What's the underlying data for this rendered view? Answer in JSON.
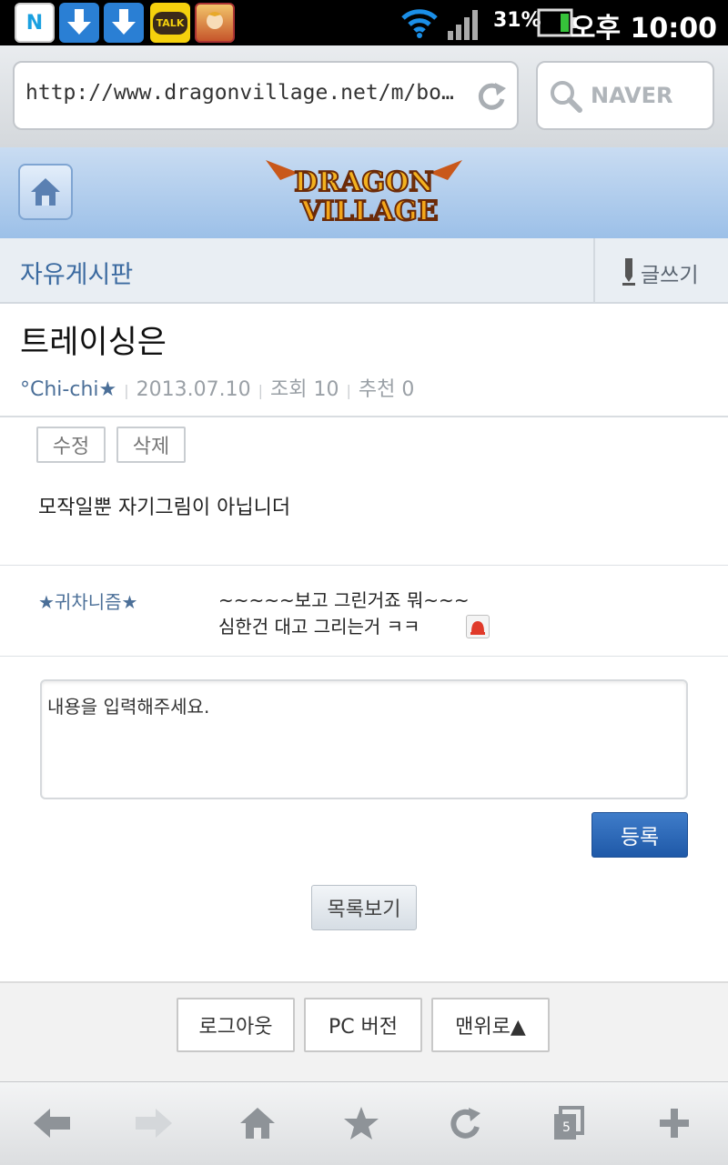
{
  "status_bar": {
    "notification_icons": [
      "naver-icon",
      "download-icon",
      "download-icon",
      "kakaotalk-icon",
      "game-app-icon"
    ],
    "kakao_label": "TALK",
    "naver_label": "N",
    "battery_percent": "31%",
    "time": "오후 10:00"
  },
  "browser": {
    "url": "http://www.dragonvillage.net/m/bo…",
    "search_placeholder": "NAVER"
  },
  "site": {
    "logo_text": "DRAGON VILLAGE",
    "board_name": "자유게시판",
    "write_label": "글쓰기"
  },
  "post": {
    "title": "트레이싱은",
    "author": "°Chi-chi★",
    "date": "2013.07.10",
    "views": "조회 10",
    "recommend": "추천 0",
    "edit_label": "수정",
    "delete_label": "삭제",
    "body": "모작일뿐 자기그림이 아닙니더"
  },
  "comments": [
    {
      "author": "★귀차니즘★",
      "lines": [
        "~~~~~보고 그린거죠 뭐~~~",
        "심한건 대고 그리는거 ㅋㅋ"
      ]
    }
  ],
  "reply": {
    "placeholder": "내용을 입력해주세요.",
    "submit_label": "등록",
    "list_label": "목록보기"
  },
  "footer": {
    "logout": "로그아웃",
    "pc_version": "PC 버전",
    "to_top": "맨위로▲"
  },
  "toolbar": {
    "tab_count": "5",
    "icons": [
      "back-arrow-icon",
      "forward-arrow-icon",
      "home-icon",
      "bookmark-star-icon",
      "refresh-icon",
      "tabs-icon",
      "add-icon"
    ]
  },
  "colors": {
    "accent_blue": "#2a63b0",
    "board_title": "#3b6aa0",
    "header_blue": "#b3cfee"
  }
}
